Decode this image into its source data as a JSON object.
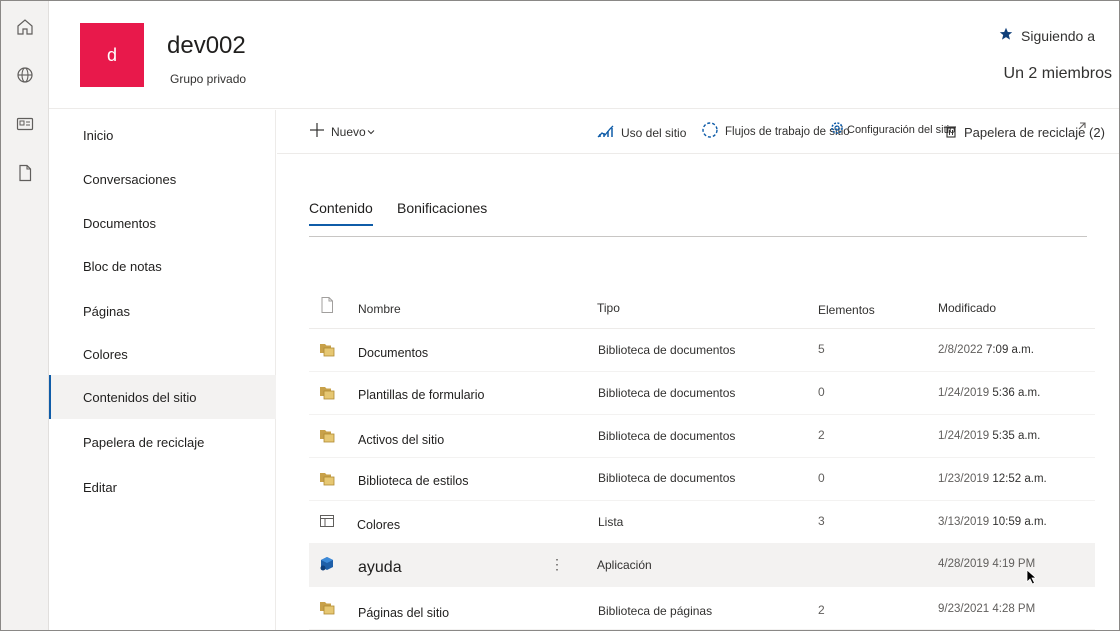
{
  "site": {
    "logo_letter": "d",
    "title": "dev002",
    "subtitle": "Grupo privado",
    "follow_label": "Siguiendo a",
    "members_label": "Un 2 miembros"
  },
  "appbar": {
    "icons": [
      "home-icon",
      "globe-icon",
      "news-icon",
      "document-icon"
    ]
  },
  "nav": {
    "items": [
      {
        "label": "Inicio"
      },
      {
        "label": "Conversaciones"
      },
      {
        "label": "Documentos"
      },
      {
        "label": "Bloc de notas"
      },
      {
        "label": "Páginas"
      },
      {
        "label": "Colores"
      },
      {
        "label": "Contenidos del sitio"
      },
      {
        "label": "Papelera de reciclaje"
      },
      {
        "label": "Editar"
      }
    ],
    "selected": "Contenidos del sitio"
  },
  "commandbar": {
    "new_label": "Nuevo",
    "usage_label": "Uso del sitio",
    "workflows_label": "Flujos de trabajo de sitio",
    "settings_label": "Configuración del sitio",
    "recycle_label": "Papelera de reciclaje (2)"
  },
  "tabs": [
    {
      "label": "Contenido",
      "active": true
    },
    {
      "label": "Bonificaciones",
      "active": false
    }
  ],
  "table": {
    "columns": {
      "name": "Nombre",
      "type": "Tipo",
      "items": "Elementos",
      "modified": "Modificado"
    },
    "rows": [
      {
        "icon": "library-icon",
        "name": "Documentos",
        "type": "Biblioteca de documentos",
        "items": "5",
        "date": "2/8/2022",
        "time": "7:09 a.m."
      },
      {
        "icon": "library-icon",
        "name": "Plantillas de formulario",
        "type": "Biblioteca de documentos",
        "items": "0",
        "date": "1/24/2019",
        "time": "5:36 a.m."
      },
      {
        "icon": "library-icon",
        "name": "Activos del sitio",
        "type": "Biblioteca de documentos",
        "items": "2",
        "date": "1/24/2019",
        "time": "5:35 a.m."
      },
      {
        "icon": "library-icon",
        "name": "Biblioteca de estilos",
        "type": "Biblioteca de documentos",
        "items": "0",
        "date": "1/23/2019",
        "time": "12:52 a.m."
      },
      {
        "icon": "list-icon",
        "name": "Colores",
        "type": "Lista",
        "items": "3",
        "date": "3/13/2019",
        "time": "10:59 a.m."
      },
      {
        "icon": "app-icon",
        "name": "ayuda",
        "type": "Aplicación",
        "items": "",
        "date": "4/28/2019 4:19 PM",
        "time": ""
      },
      {
        "icon": "library-icon",
        "name": "Páginas del sitio",
        "type": "Biblioteca de páginas",
        "items": "2",
        "date": "9/23/2021 4:28 PM",
        "time": ""
      }
    ]
  },
  "colors": {
    "accent": "#0f5ca8",
    "logo_bg": "#e8194b",
    "folder": "#c8a14a"
  }
}
